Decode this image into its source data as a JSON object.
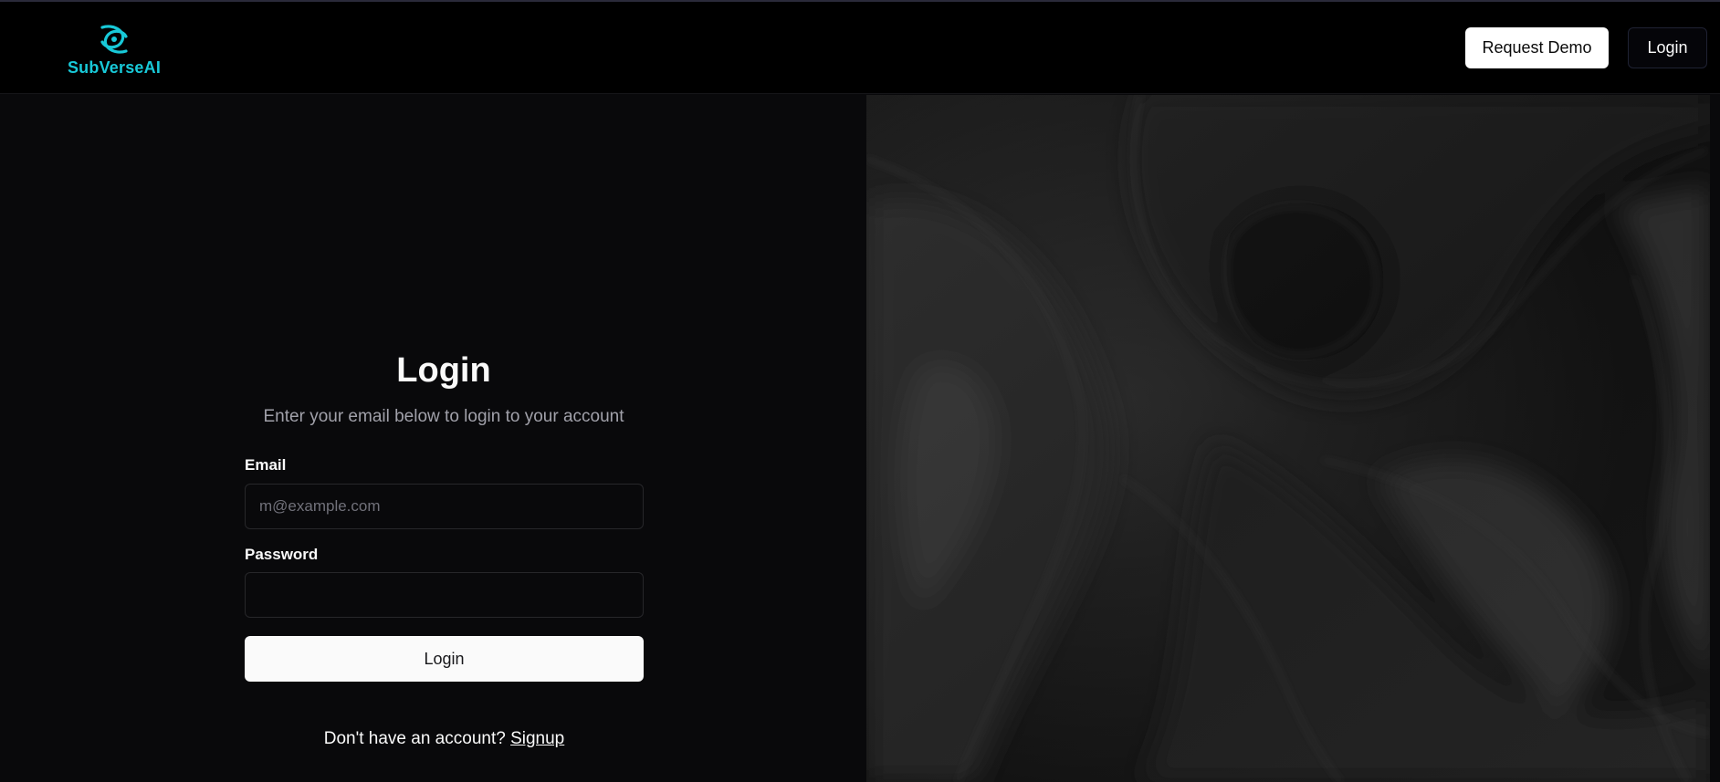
{
  "brand": {
    "name": "SubVerseAI",
    "accent_color": "#18c9d8",
    "logo_icon": "interlocking-orbit-logo"
  },
  "nav": {
    "request_demo_label": "Request Demo",
    "login_label": "Login"
  },
  "form": {
    "title": "Login",
    "subtitle": "Enter your email below to login to your account",
    "email_label": "Email",
    "email_placeholder": "m@example.com",
    "email_value": "",
    "password_label": "Password",
    "password_value": "",
    "submit_label": "Login",
    "signup_prompt": "Don't have an account?",
    "signup_link": "Signup"
  },
  "hero_image": {
    "description_icon": "dark-liquid-swirl-image"
  }
}
